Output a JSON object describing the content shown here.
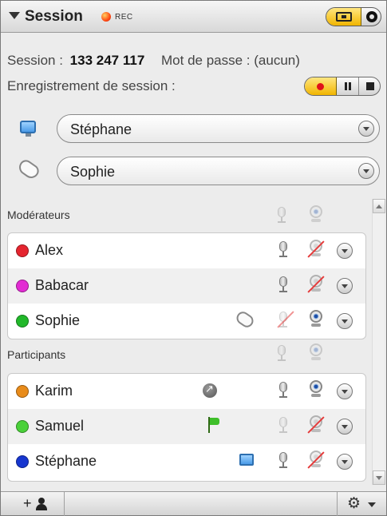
{
  "header": {
    "title": "Session",
    "rec_label": "REC"
  },
  "session": {
    "label": "Session :",
    "id": "133 247 117",
    "password_text": "Mot de passe : (aucun)",
    "recording_label": "Enregistrement de session :"
  },
  "selectors": {
    "presenter": "Stéphane",
    "controller": "Sophie"
  },
  "moderators": {
    "label": "Modérateurs",
    "rows": [
      {
        "name": "Alex",
        "color": "#e5252f"
      },
      {
        "name": "Babacar",
        "color": "#e22bd3"
      },
      {
        "name": "Sophie",
        "color": "#21b82a"
      }
    ]
  },
  "participants": {
    "label": "Participants",
    "rows": [
      {
        "name": "Karim",
        "color": "#e88b1a"
      },
      {
        "name": "Samuel",
        "color": "#4ad13a"
      },
      {
        "name": "Stéphane",
        "color": "#1636cf"
      }
    ]
  },
  "footer": {
    "add_label": "+"
  }
}
